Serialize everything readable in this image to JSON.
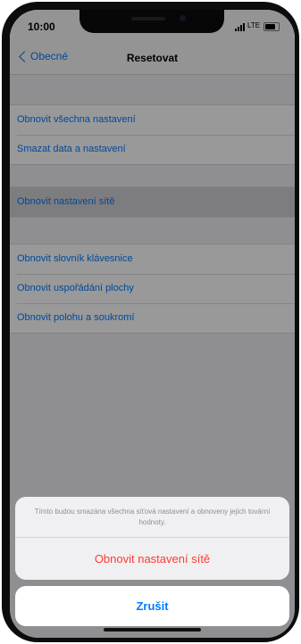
{
  "status_bar": {
    "time": "10:00",
    "network": "LTE"
  },
  "nav": {
    "back_label": "Obecné",
    "title": "Resetovat"
  },
  "groups": [
    {
      "items": [
        {
          "label": "Obnovit všechna nastavení"
        },
        {
          "label": "Smazat data a nastavení"
        }
      ]
    },
    {
      "items": [
        {
          "label": "Obnovit nastavení sítě",
          "selected": true
        }
      ]
    },
    {
      "items": [
        {
          "label": "Obnovit slovník klávesnice"
        },
        {
          "label": "Obnovit uspořádání plochy"
        },
        {
          "label": "Obnovit polohu a soukromí"
        }
      ]
    }
  ],
  "action_sheet": {
    "message": "Tímto budou smazána všechna síťová nastavení a obnoveny jejich tovární hodnoty.",
    "destructive_label": "Obnovit nastavení sítě",
    "cancel_label": "Zrušit"
  },
  "colors": {
    "accent": "#007aff",
    "destructive": "#ff3b30",
    "background": "#efeff4"
  }
}
